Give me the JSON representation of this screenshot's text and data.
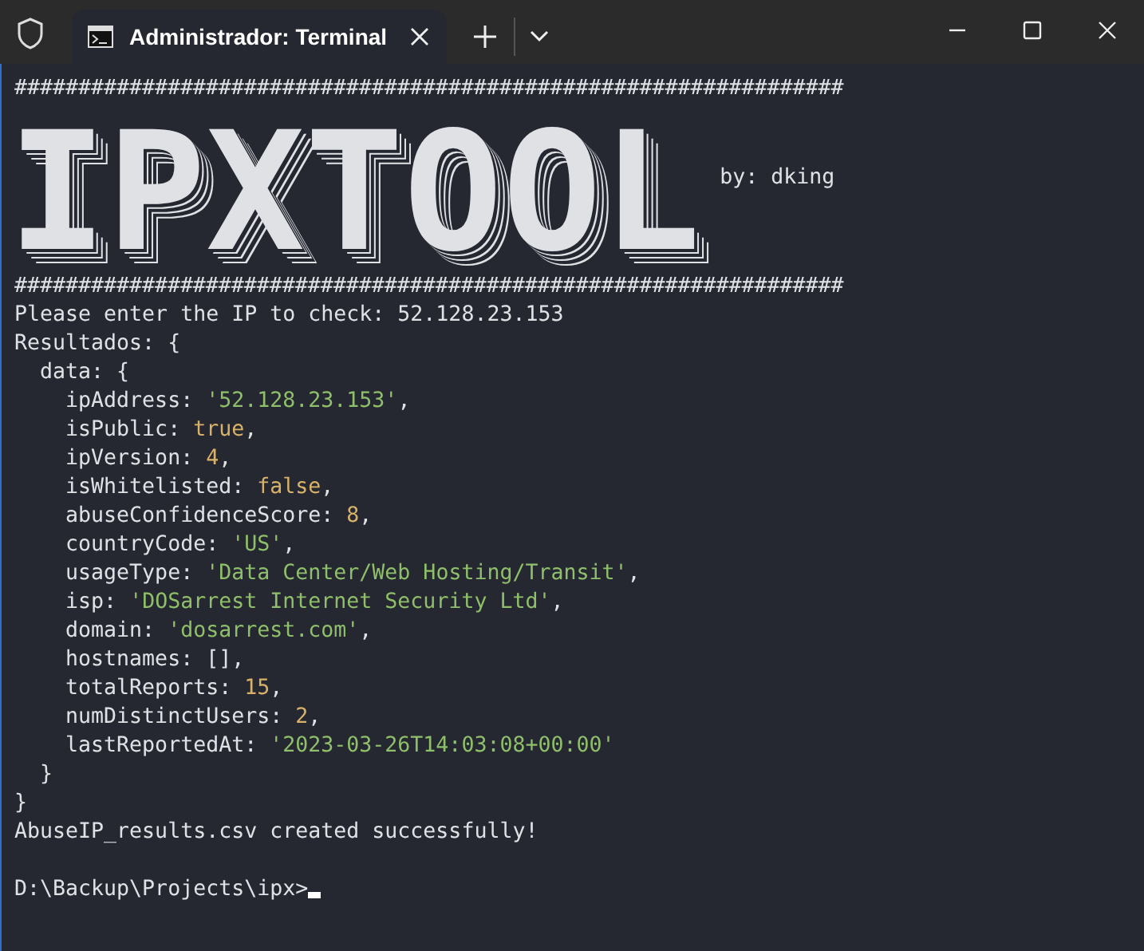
{
  "window": {
    "tabs": [
      {
        "title": "Administrador: Terminal",
        "selected": true
      }
    ]
  },
  "banner": {
    "rule_top": "#################################################################",
    "title": "IPXTOOL",
    "author": "by: dking",
    "rule_bottom": "#################################################################"
  },
  "lines": [
    {
      "kind": "output",
      "segments": [
        {
          "kind": "text",
          "text": "Please enter the IP to check: 52.128.23.153"
        }
      ]
    },
    {
      "kind": "output",
      "segments": [
        {
          "kind": "text",
          "text": "Resultados: {"
        }
      ]
    },
    {
      "kind": "output",
      "segments": [
        {
          "kind": "text",
          "text": "  data: {"
        }
      ]
    },
    {
      "kind": "output",
      "segments": [
        {
          "kind": "text",
          "text": "    ipAddress: "
        },
        {
          "kind": "string",
          "text": "'52.128.23.153'"
        },
        {
          "kind": "text",
          "text": ","
        }
      ]
    },
    {
      "kind": "output",
      "segments": [
        {
          "kind": "text",
          "text": "    isPublic: "
        },
        {
          "kind": "literal",
          "text": "true"
        },
        {
          "kind": "text",
          "text": ","
        }
      ]
    },
    {
      "kind": "output",
      "segments": [
        {
          "kind": "text",
          "text": "    ipVersion: "
        },
        {
          "kind": "literal",
          "text": "4"
        },
        {
          "kind": "text",
          "text": ","
        }
      ]
    },
    {
      "kind": "output",
      "segments": [
        {
          "kind": "text",
          "text": "    isWhitelisted: "
        },
        {
          "kind": "literal",
          "text": "false"
        },
        {
          "kind": "text",
          "text": ","
        }
      ]
    },
    {
      "kind": "output",
      "segments": [
        {
          "kind": "text",
          "text": "    abuseConfidenceScore: "
        },
        {
          "kind": "literal",
          "text": "8"
        },
        {
          "kind": "text",
          "text": ","
        }
      ]
    },
    {
      "kind": "output",
      "segments": [
        {
          "kind": "text",
          "text": "    countryCode: "
        },
        {
          "kind": "string",
          "text": "'US'"
        },
        {
          "kind": "text",
          "text": ","
        }
      ]
    },
    {
      "kind": "output",
      "segments": [
        {
          "kind": "text",
          "text": "    usageType: "
        },
        {
          "kind": "string",
          "text": "'Data Center/Web Hosting/Transit'"
        },
        {
          "kind": "text",
          "text": ","
        }
      ]
    },
    {
      "kind": "output",
      "segments": [
        {
          "kind": "text",
          "text": "    isp: "
        },
        {
          "kind": "string",
          "text": "'DOSarrest Internet Security Ltd'"
        },
        {
          "kind": "text",
          "text": ","
        }
      ]
    },
    {
      "kind": "output",
      "segments": [
        {
          "kind": "text",
          "text": "    domain: "
        },
        {
          "kind": "string",
          "text": "'dosarrest.com'"
        },
        {
          "kind": "text",
          "text": ","
        }
      ]
    },
    {
      "kind": "output",
      "segments": [
        {
          "kind": "text",
          "text": "    hostnames: [],"
        }
      ]
    },
    {
      "kind": "output",
      "segments": [
        {
          "kind": "text",
          "text": "    totalReports: "
        },
        {
          "kind": "literal",
          "text": "15"
        },
        {
          "kind": "text",
          "text": ","
        }
      ]
    },
    {
      "kind": "output",
      "segments": [
        {
          "kind": "text",
          "text": "    numDistinctUsers: "
        },
        {
          "kind": "literal",
          "text": "2"
        },
        {
          "kind": "text",
          "text": ","
        }
      ]
    },
    {
      "kind": "output",
      "segments": [
        {
          "kind": "text",
          "text": "    lastReportedAt: "
        },
        {
          "kind": "string",
          "text": "'2023-03-26T14:03:08+00:00'"
        }
      ]
    },
    {
      "kind": "output",
      "segments": [
        {
          "kind": "text",
          "text": "  }"
        }
      ]
    },
    {
      "kind": "output",
      "segments": [
        {
          "kind": "text",
          "text": "}"
        }
      ]
    },
    {
      "kind": "output",
      "segments": [
        {
          "kind": "text",
          "text": "AbuseIP_results.csv created successfully!"
        }
      ]
    },
    {
      "kind": "blank"
    },
    {
      "kind": "prompt",
      "text": "D:\\Backup\\Projects\\ipx>"
    }
  ]
}
